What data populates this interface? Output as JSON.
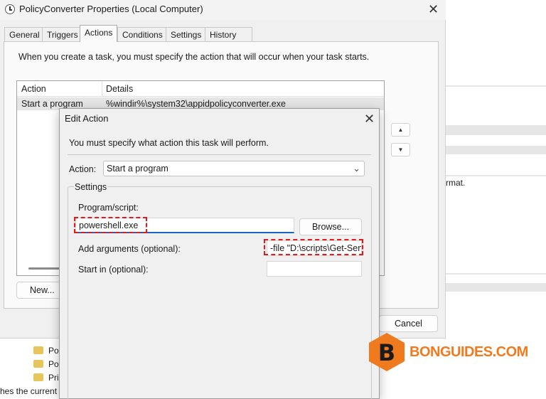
{
  "background": {
    "folders": [
      "Po",
      "Po",
      "Pri"
    ],
    "status_text": "hes the current",
    "right_text": "rmat."
  },
  "properties_window": {
    "title": "PolicyConverter Properties (Local Computer)",
    "tabs": [
      "General",
      "Triggers",
      "Actions",
      "Conditions",
      "Settings",
      "History (disabled)"
    ],
    "active_tab": "Actions",
    "intro_text": "When you create a task, you must specify the action that will occur when your task starts.",
    "list": {
      "columns": [
        "Action",
        "Details"
      ],
      "rows": [
        {
          "action": "Start a program",
          "details": "%windir%\\system32\\appidpolicyconverter.exe"
        }
      ]
    },
    "up_glyph": "▲",
    "down_glyph": "▼",
    "new_button": "New...",
    "cancel_button": "Cancel"
  },
  "edit_action": {
    "title": "Edit Action",
    "description": "You must specify what action this task will perform.",
    "action_label": "Action:",
    "action_value": "Start a program",
    "settings_label": "Settings",
    "program_label": "Program/script:",
    "program_value": "powershell.exe",
    "browse_button": "Browse...",
    "arguments_label": "Add arguments (optional):",
    "arguments_value": "-file \"D:\\scripts\\Get-Serv",
    "start_in_label": "Start in (optional):",
    "start_in_value": ""
  },
  "watermark": {
    "letter": "B",
    "text": "BONGUIDES.COM",
    "color": "#f07b1e"
  },
  "colors": {
    "highlight": "#e01b1b",
    "focus": "#1a63c6"
  }
}
